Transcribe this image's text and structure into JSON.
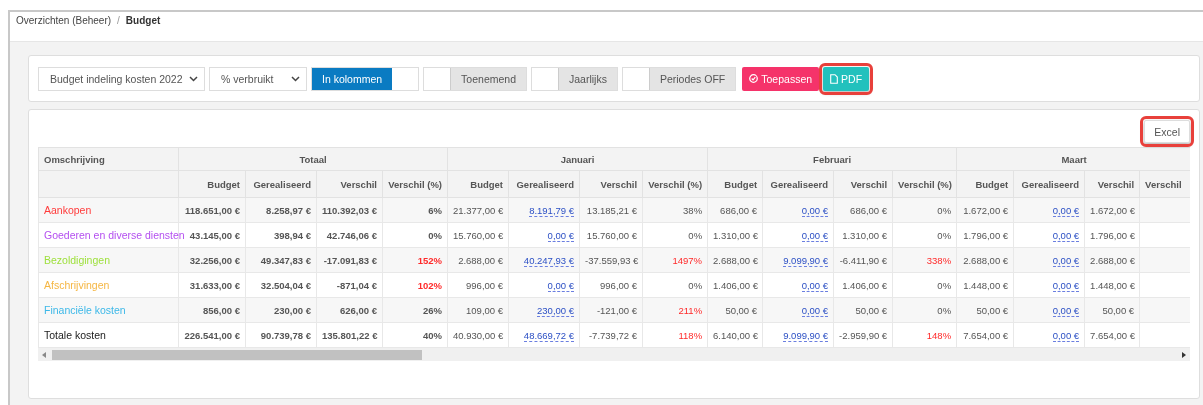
{
  "breadcrumb": {
    "separator": "/",
    "items": [
      {
        "label": "Overzichten (Beheer)",
        "current": false
      },
      {
        "label": "Budget",
        "current": true
      }
    ]
  },
  "toolbar": {
    "selects": [
      {
        "value": "Budget indeling kosten 2022"
      },
      {
        "value": "% verbruikt"
      }
    ],
    "toggles": [
      {
        "label": "In kolommen",
        "on": true
      },
      {
        "label": "Toenemend",
        "on": false
      },
      {
        "label": "Jaarlijks",
        "on": false
      },
      {
        "label": "Periodes OFF",
        "on": false
      }
    ],
    "apply_button": {
      "label": "Toepassen",
      "highlighted": false
    },
    "pdf_button": {
      "label": "PDF",
      "highlighted": true
    }
  },
  "excel_button": {
    "label": "Excel",
    "highlighted": true
  },
  "table": {
    "first_column": "Omschrijving",
    "periods": [
      {
        "name": "Totaal",
        "kind": "total",
        "columns": [
          "Budget",
          "Gerealiseerd",
          "Verschil",
          "Verschil (%)"
        ]
      },
      {
        "name": "Januari",
        "kind": "month",
        "columns": [
          "Budget",
          "Gerealiseerd",
          "Verschil",
          "Verschil (%)"
        ]
      },
      {
        "name": "Februari",
        "kind": "month",
        "columns": [
          "Budget",
          "Gerealiseerd",
          "Verschil",
          "Verschil (%)"
        ]
      },
      {
        "name": "Maart",
        "kind": "month",
        "columns": [
          "Budget",
          "Gerealiseerd",
          "Verschil",
          "Verschil"
        ]
      }
    ],
    "rows": [
      {
        "label": "Aankopen",
        "color": "#ff3b3b",
        "cells": [
          {
            "values": [
              "118.651,00 €",
              "8.258,97 €",
              "110.392,03 €"
            ],
            "pct": "6%",
            "over": false
          },
          {
            "values": [
              "21.377,00 €",
              "8.191,79 €",
              "13.185,21 €"
            ],
            "pct": "38%",
            "over": false
          },
          {
            "values": [
              "686,00 €",
              "0,00 €",
              "686,00 €"
            ],
            "pct": "0%",
            "over": false
          },
          {
            "values": [
              "1.672,00 €",
              "0,00 €",
              "1.672,00 €"
            ]
          }
        ]
      },
      {
        "label": "Goederen en diverse diensten",
        "color": "#b44ff0",
        "cells": [
          {
            "values": [
              "43.145,00 €",
              "398,94 €",
              "42.746,06 €"
            ],
            "pct": "0%",
            "over": false
          },
          {
            "values": [
              "15.760,00 €",
              "0,00 €",
              "15.760,00 €"
            ],
            "pct": "0%",
            "over": false
          },
          {
            "values": [
              "1.310,00 €",
              "0,00 €",
              "1.310,00 €"
            ],
            "pct": "0%",
            "over": false
          },
          {
            "values": [
              "1.796,00 €",
              "0,00 €",
              "1.796,00 €"
            ]
          }
        ]
      },
      {
        "label": "Bezoldigingen",
        "color": "#9ee03c",
        "cells": [
          {
            "values": [
              "32.256,00 €",
              "49.347,83 €",
              "-17.091,83 €"
            ],
            "pct": "152%",
            "over": true
          },
          {
            "values": [
              "2.688,00 €",
              "40.247,93 €",
              "-37.559,93 €"
            ],
            "pct": "1497%",
            "over": true
          },
          {
            "values": [
              "2.688,00 €",
              "9.099,90 €",
              "-6.411,90 €"
            ],
            "pct": "338%",
            "over": true
          },
          {
            "values": [
              "2.688,00 €",
              "0,00 €",
              "2.688,00 €"
            ]
          }
        ]
      },
      {
        "label": "Afschrijvingen",
        "color": "#f5b642",
        "cells": [
          {
            "values": [
              "31.633,00 €",
              "32.504,04 €",
              "-871,04 €"
            ],
            "pct": "102%",
            "over": true
          },
          {
            "values": [
              "996,00 €",
              "0,00 €",
              "996,00 €"
            ],
            "pct": "0%",
            "over": false
          },
          {
            "values": [
              "1.406,00 €",
              "0,00 €",
              "1.406,00 €"
            ],
            "pct": "0%",
            "over": false
          },
          {
            "values": [
              "1.448,00 €",
              "0,00 €",
              "1.448,00 €"
            ]
          }
        ]
      },
      {
        "label": "Financiële kosten",
        "color": "#3cb8e8",
        "cells": [
          {
            "values": [
              "856,00 €",
              "230,00 €",
              "626,00 €"
            ],
            "pct": "26%",
            "over": false
          },
          {
            "values": [
              "109,00 €",
              "230,00 €",
              "-121,00 €"
            ],
            "pct": "211%",
            "over": true
          },
          {
            "values": [
              "50,00 €",
              "0,00 €",
              "50,00 €"
            ],
            "pct": "0%",
            "over": false
          },
          {
            "values": [
              "50,00 €",
              "0,00 €",
              "50,00 €"
            ]
          }
        ]
      },
      {
        "label": "Totale kosten",
        "color": "#222222",
        "cells": [
          {
            "values": [
              "226.541,00 €",
              "90.739,78 €",
              "135.801,22 €"
            ],
            "pct": "40%",
            "over": false
          },
          {
            "values": [
              "40.930,00 €",
              "48.669,72 €",
              "-7.739,72 €"
            ],
            "pct": "118%",
            "over": true
          },
          {
            "values": [
              "6.140,00 €",
              "9.099,90 €",
              "-2.959,90 €"
            ],
            "pct": "148%",
            "over": true
          },
          {
            "values": [
              "7.654,00 €",
              "0,00 €",
              "7.654,00 €"
            ]
          }
        ]
      }
    ]
  }
}
